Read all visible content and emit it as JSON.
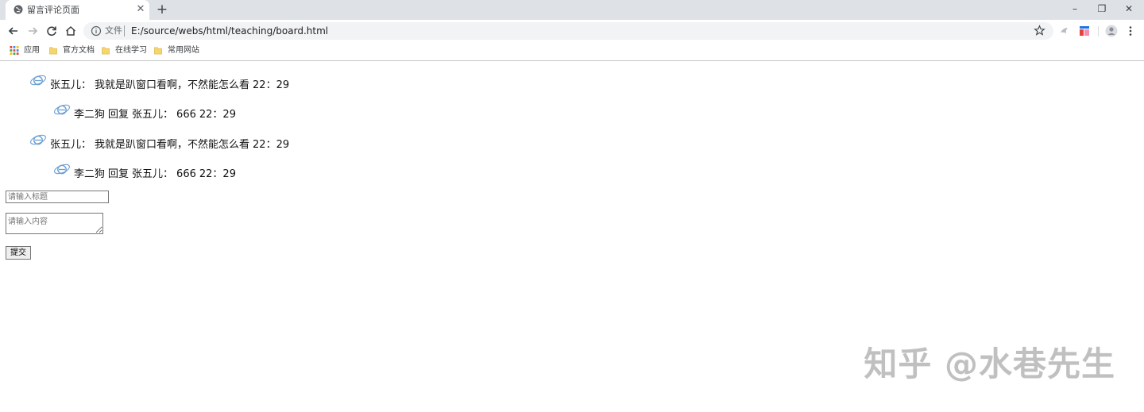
{
  "browser": {
    "tab": {
      "title": "留言评论页面",
      "close_glyph": "✕"
    },
    "new_tab_glyph": "+",
    "window_controls": {
      "minimize": "–",
      "restore": "❐",
      "close": "✕"
    },
    "address": {
      "scheme_label": "文件",
      "url": "E:/source/webs/html/teaching/board.html"
    },
    "bookmarks": [
      {
        "label": "应用",
        "icon": "apps-grid-icon"
      },
      {
        "label": "官方文档",
        "icon": "folder-icon"
      },
      {
        "label": "在线学习",
        "icon": "folder-icon"
      },
      {
        "label": "常用网站",
        "icon": "folder-icon"
      }
    ]
  },
  "messages": [
    {
      "name": "张五儿：",
      "content": "我就是趴窗口看啊，不然能怎么看",
      "time": "22：29",
      "avatar": "ie-logo-icon"
    },
    {
      "reply_from": "李二狗",
      "reply_word": "回复",
      "reply_to": "张五儿：",
      "content": "666",
      "time": "22：29",
      "avatar": "ie-logo-icon"
    },
    {
      "name": "张五儿：",
      "content": "我就是趴窗口看啊，不然能怎么看",
      "time": "22：29",
      "avatar": "ie-logo-icon"
    },
    {
      "reply_from": "李二狗",
      "reply_word": "回复",
      "reply_to": "张五儿：",
      "content": "666",
      "time": "22：29",
      "avatar": "ie-logo-icon"
    }
  ],
  "form": {
    "title_placeholder": "请输入标题",
    "content_placeholder": "请输入内容",
    "submit_label": "提交"
  },
  "watermark": "知乎 @水巷先生",
  "colors": {
    "tabstrip": "#dee1e6",
    "omnibox": "#f1f3f4",
    "folder": "#f6d66b",
    "avatar": "#6a9fd4"
  }
}
